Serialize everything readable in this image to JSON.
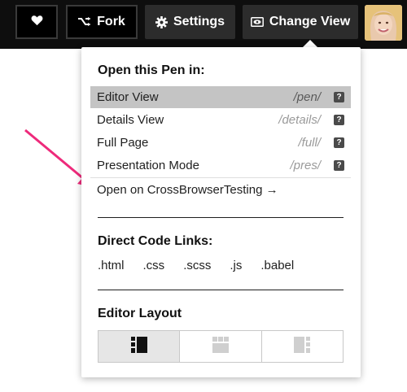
{
  "topbar": {
    "fork_label": "Fork",
    "settings_label": "Settings",
    "change_view_label": "Change View"
  },
  "dropdown": {
    "open_heading": "Open this Pen in:",
    "views": [
      {
        "label": "Editor View",
        "path": "/pen/",
        "active": true
      },
      {
        "label": "Details View",
        "path": "/details/",
        "active": false
      },
      {
        "label": "Full Page",
        "path": "/full/",
        "active": false
      },
      {
        "label": "Presentation Mode",
        "path": "/pres/",
        "active": false
      }
    ],
    "help_glyph": "?",
    "crossbrowser": "Open on CrossBrowserTesting →",
    "code_heading": "Direct Code Links:",
    "code_links": [
      ".html",
      ".css",
      ".scss",
      ".js",
      ".babel"
    ],
    "layout_heading": "Editor Layout",
    "layout_selected": 0
  },
  "colors": {
    "topbar": "#0e0e0e",
    "button_fill": "#2c2c2c",
    "active_row": "#c4c4c4",
    "arrow": "#ee2a7b"
  },
  "icons": [
    "heart-icon",
    "fork-icon",
    "gear-icon",
    "eye-icon",
    "help-icon",
    "layout-left-icon",
    "layout-top-icon",
    "layout-right-icon"
  ]
}
